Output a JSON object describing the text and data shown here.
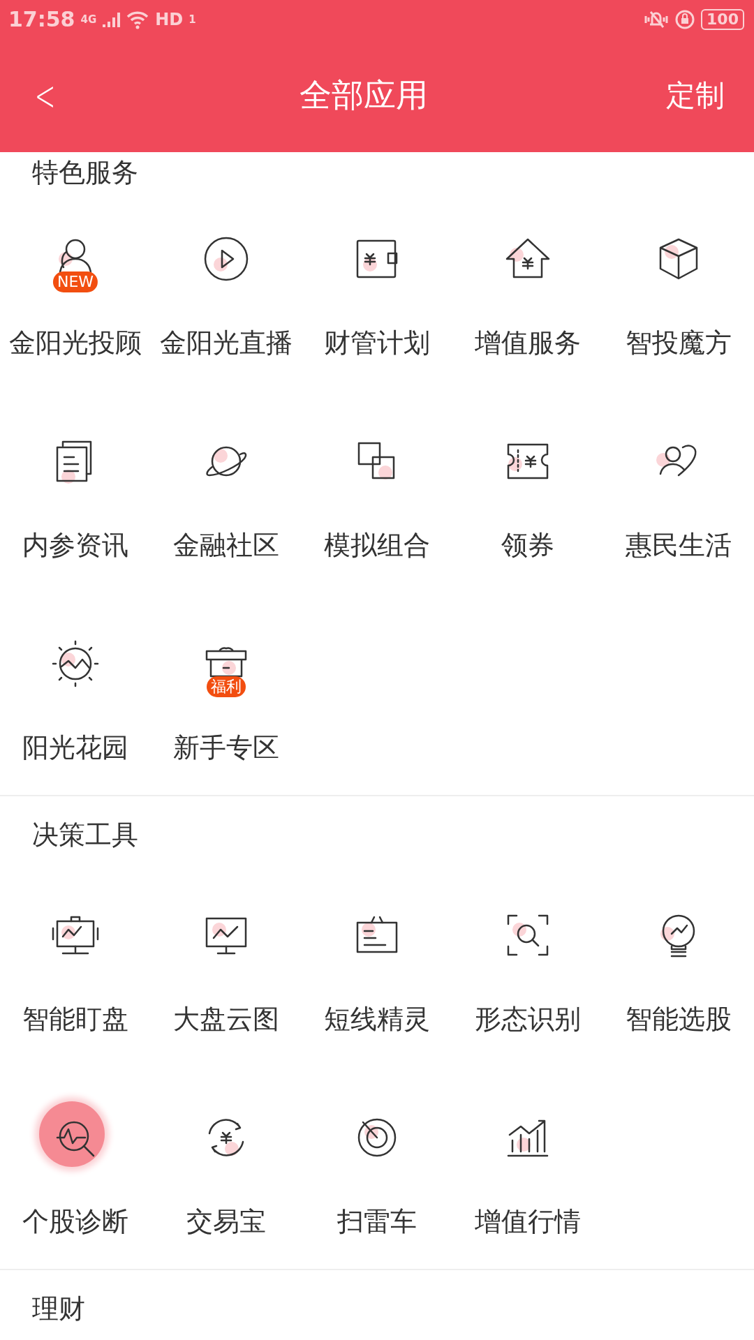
{
  "status_bar": {
    "time": "17:58",
    "network": "4G",
    "hd": "HD",
    "sim": "1",
    "battery": "100"
  },
  "header": {
    "back": "<",
    "title": "全部应用",
    "action": "定制"
  },
  "sections": [
    {
      "title": "特色服务",
      "items": [
        {
          "label": "金阳光投顾",
          "badge": "NEW",
          "pressed": false
        },
        {
          "label": "金阳光直播",
          "pressed": false
        },
        {
          "label": "财管计划",
          "pressed": false
        },
        {
          "label": "增值服务",
          "pressed": false
        },
        {
          "label": "智投魔方",
          "pressed": false
        },
        {
          "label": "内参资讯",
          "pressed": false
        },
        {
          "label": "金融社区",
          "pressed": false
        },
        {
          "label": "模拟组合",
          "pressed": false
        },
        {
          "label": "领券",
          "pressed": false
        },
        {
          "label": "惠民生活",
          "pressed": false
        },
        {
          "label": "阳光花园",
          "pressed": false
        },
        {
          "label": "新手专区",
          "badge": "福利",
          "pressed": false
        }
      ]
    },
    {
      "title": "决策工具",
      "items": [
        {
          "label": "智能盯盘",
          "pressed": false
        },
        {
          "label": "大盘云图",
          "pressed": false
        },
        {
          "label": "短线精灵",
          "pressed": false
        },
        {
          "label": "形态识别",
          "pressed": false
        },
        {
          "label": "智能选股",
          "pressed": false
        },
        {
          "label": "个股诊断",
          "pressed": true
        },
        {
          "label": "交易宝",
          "pressed": false
        },
        {
          "label": "扫雷车",
          "pressed": false
        },
        {
          "label": "增值行情",
          "pressed": false
        }
      ]
    },
    {
      "title": "理财"
    }
  ]
}
